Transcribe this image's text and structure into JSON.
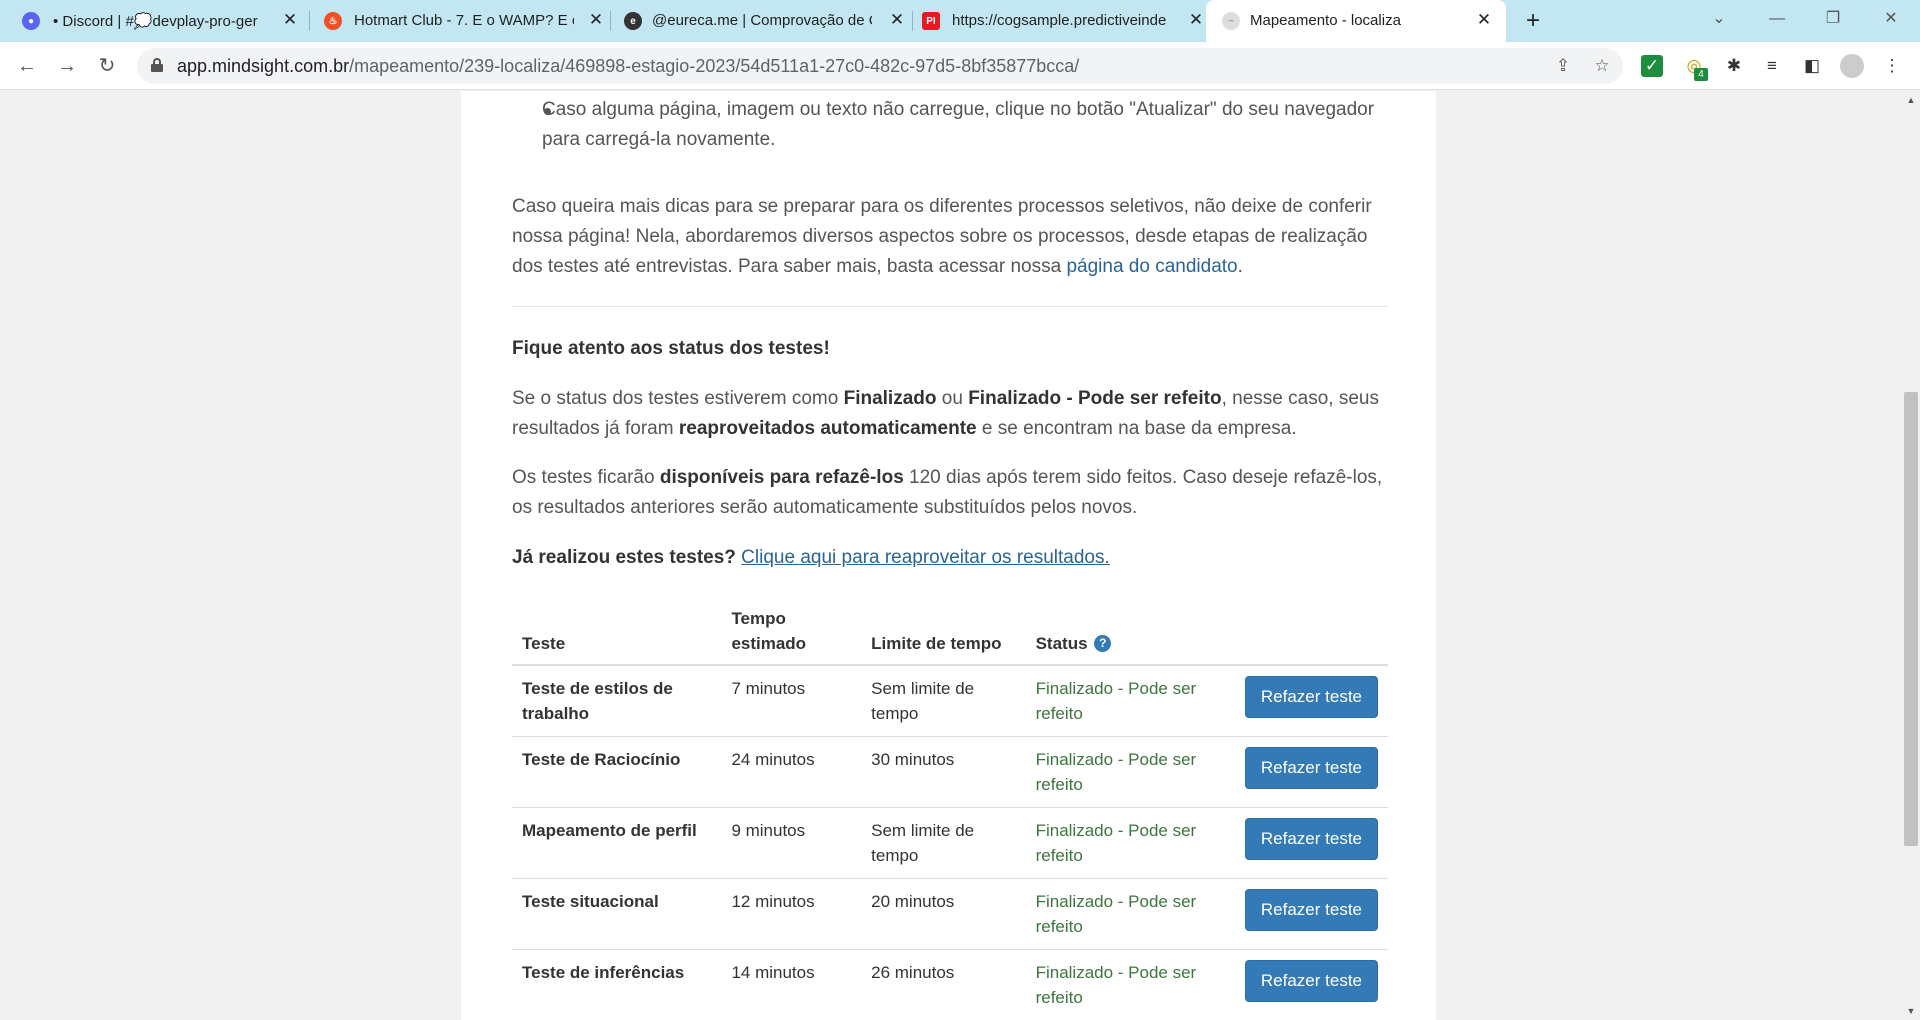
{
  "browser": {
    "tabs": [
      {
        "title": "• Discord | #💭devplay-pro-ger",
        "favicon": "discord-icon",
        "color": "#5865f2"
      },
      {
        "title": "Hotmart Club - 7. E o WAMP? E o",
        "favicon": "hotmart-icon",
        "color": "#f04e23"
      },
      {
        "title": "@eureca.me | Comprovação de C",
        "favicon": "eureca-icon",
        "color": "#333333"
      },
      {
        "title": "https://cogsample.predictiveinde",
        "favicon": "pi-icon",
        "color": "#e31b23"
      },
      {
        "title": "Mapeamento - localiza",
        "favicon": "mindsight-icon",
        "color": "#cccccc"
      }
    ],
    "url_host": "app.mindsight.com.br",
    "url_path": "/mapeamento/239-localiza/469898-estagio-2023/54d511a1-27c0-482c-97d5-8bf35877bcca/",
    "extension_badge": "4"
  },
  "page": {
    "bullet_text": "Caso alguma página, imagem ou texto não carregue, clique no botão \"Atualizar\" do seu navegador para carregá-la novamente.",
    "tips_text": "Caso queira mais dicas para se preparar para os diferentes processos seletivos, não deixe de conferir nossa página! Nela, abordaremos diversos aspectos sobre os processos, desde etapas de realização dos testes até entrevistas. Para saber mais, basta acessar nossa ",
    "tips_link": "página do candidato",
    "status_heading": "Fique atento aos status dos testes!",
    "para1": {
      "a": "Se o status dos testes estiverem como ",
      "b1": "Finalizado",
      "c": " ou ",
      "b2": "Finalizado - Pode ser refeito",
      "d": ", nesse caso, seus resultados já foram ",
      "b3": "reaproveitados automaticamente",
      "e": " e se encontram na base da empresa."
    },
    "para2": {
      "a": "Os testes ficarão ",
      "b1": "disponíveis para refazê-los",
      "c": " 120 dias após terem sido feitos. Caso deseje refazê-los, os resultados anteriores serão automaticamente substituídos pelos novos."
    },
    "reuse_question": "Já realizou estes testes?",
    "reuse_link": "Clique aqui para reaproveitar os resultados."
  },
  "table": {
    "headers": {
      "test": "Teste",
      "time": "Tempo estimado",
      "limit": "Limite de tempo",
      "status": "Status"
    },
    "rows": [
      {
        "name": "Teste de estilos de trabalho",
        "time": "7 minutos",
        "limit": "Sem limite de tempo",
        "status": "Finalizado - Pode ser refeito",
        "action": "Refazer teste"
      },
      {
        "name": "Teste de Raciocínio",
        "time": "24 minutos",
        "limit": "30 minutos",
        "status": "Finalizado - Pode ser refeito",
        "action": "Refazer teste"
      },
      {
        "name": "Mapeamento de perfil",
        "time": "9 minutos",
        "limit": "Sem limite de tempo",
        "status": "Finalizado - Pode ser refeito",
        "action": "Refazer teste"
      },
      {
        "name": "Teste situacional",
        "time": "12 minutos",
        "limit": "20 minutos",
        "status": "Finalizado - Pode ser refeito",
        "action": "Refazer teste"
      },
      {
        "name": "Teste de inferências",
        "time": "14 minutos",
        "limit": "26 minutos",
        "status": "Finalizado - Pode ser refeito",
        "action": "Refazer teste"
      }
    ]
  },
  "colors": {
    "accent": "#337ab7",
    "status_green": "#3c763d",
    "link": "#2a6496",
    "tabstrip": "#c2e7f2"
  }
}
